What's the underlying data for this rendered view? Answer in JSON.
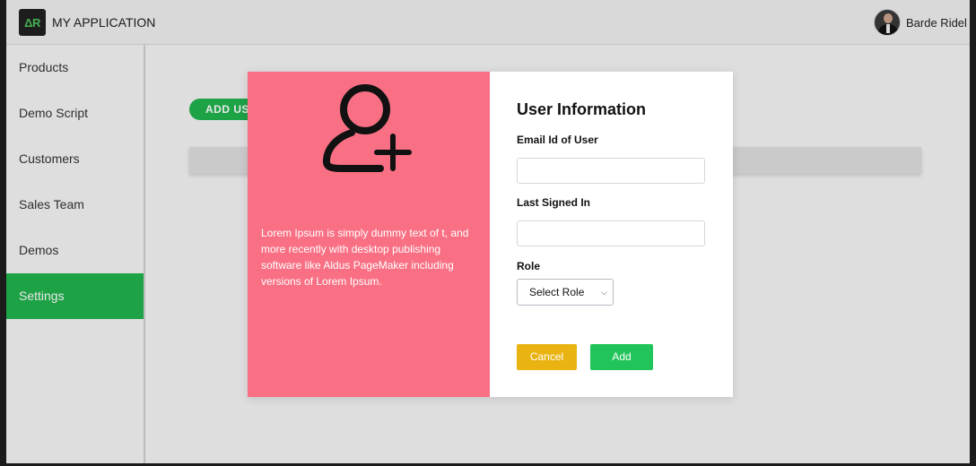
{
  "header": {
    "logo_text": "ΔR",
    "app_title": "MY APPLICATION",
    "user_name": "Barde Ridel"
  },
  "sidebar": {
    "items": [
      {
        "label": "Products"
      },
      {
        "label": "Demo Script"
      },
      {
        "label": "Customers"
      },
      {
        "label": "Sales Team"
      },
      {
        "label": "Demos"
      },
      {
        "label": "Settings",
        "active": true
      }
    ]
  },
  "main": {
    "add_user_label": "ADD USER"
  },
  "modal": {
    "description": "Lorem Ipsum is simply dummy text of t, and more recently with desktop publishing software like Aldus PageMaker including versions of Lorem Ipsum.",
    "title": "User Information",
    "email_label": "Email Id of User",
    "email_value": "",
    "last_signed_label": "Last Signed In",
    "last_signed_value": "",
    "role_label": "Role",
    "role_selected": "Select Role",
    "cancel_label": "Cancel",
    "add_label": "Add",
    "icon": "user-add-icon"
  },
  "colors": {
    "accent_green": "#21b24e",
    "modal_pink": "#f97084",
    "cancel_yellow": "#e9b311"
  }
}
